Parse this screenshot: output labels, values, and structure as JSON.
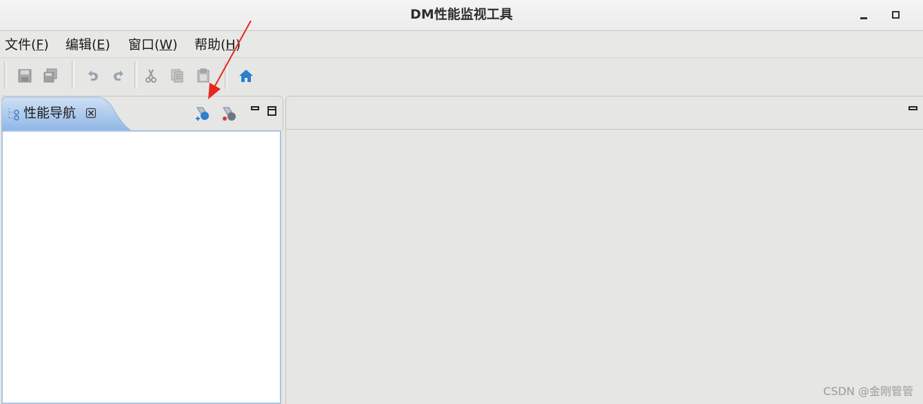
{
  "window": {
    "title": "DM性能监视工具",
    "minimize_icon": "minimize-icon",
    "maximize_icon": "maximize-icon"
  },
  "menubar": {
    "items": [
      {
        "label": "文件(",
        "key": "F",
        "suffix": ")"
      },
      {
        "label": "编辑(",
        "key": "E",
        "suffix": ")"
      },
      {
        "label": "窗口(",
        "key": "W",
        "suffix": ")"
      },
      {
        "label": "帮助(",
        "key": "H",
        "suffix": ")"
      }
    ]
  },
  "toolbar": {
    "buttons": [
      "save-icon",
      "save-all-icon",
      "undo-icon",
      "redo-icon",
      "cut-icon",
      "copy-icon",
      "paste-icon",
      "home-icon"
    ],
    "home_color": "#2d7fd0"
  },
  "navigator": {
    "tab_label": "性能导航",
    "tab_icon": "tree-navigator-icon",
    "tools": [
      "add-connection-icon",
      "remove-connection-icon"
    ],
    "tab_color": "#9cc0ea"
  },
  "watermark": "CSDN @金刚管管",
  "annotation": {
    "color": "#e8261c"
  }
}
